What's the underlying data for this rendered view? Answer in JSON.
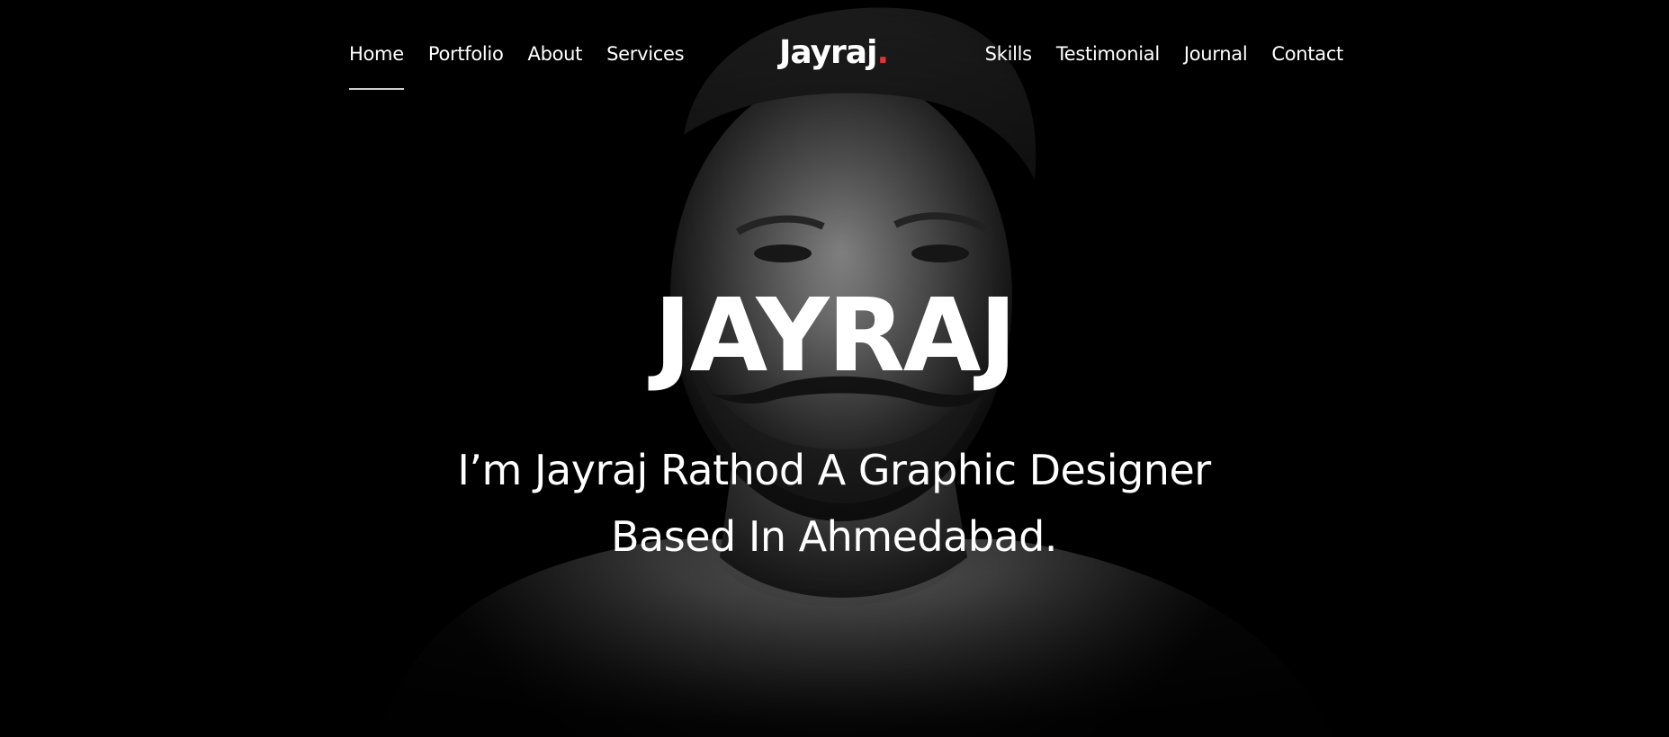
{
  "nav": {
    "left_items": [
      "Home",
      "Portfolio",
      "About",
      "Services"
    ],
    "right_items": [
      "Skills",
      "Testimonial",
      "Journal",
      "Contact"
    ],
    "active_item": "Home"
  },
  "logo": {
    "text": "Jayraj",
    "dot": ".",
    "dot_color": "#e0333a"
  },
  "hero": {
    "title": "JAYRAJ",
    "subtitle_line1": "I’m Jayraj Rathod A Graphic Designer",
    "subtitle_line2": "Based In Ahmedabad.",
    "background_image": "monochrome-portrait-photo"
  },
  "colors": {
    "background": "#000000",
    "text": "#ffffff",
    "accent": "#e0333a"
  }
}
